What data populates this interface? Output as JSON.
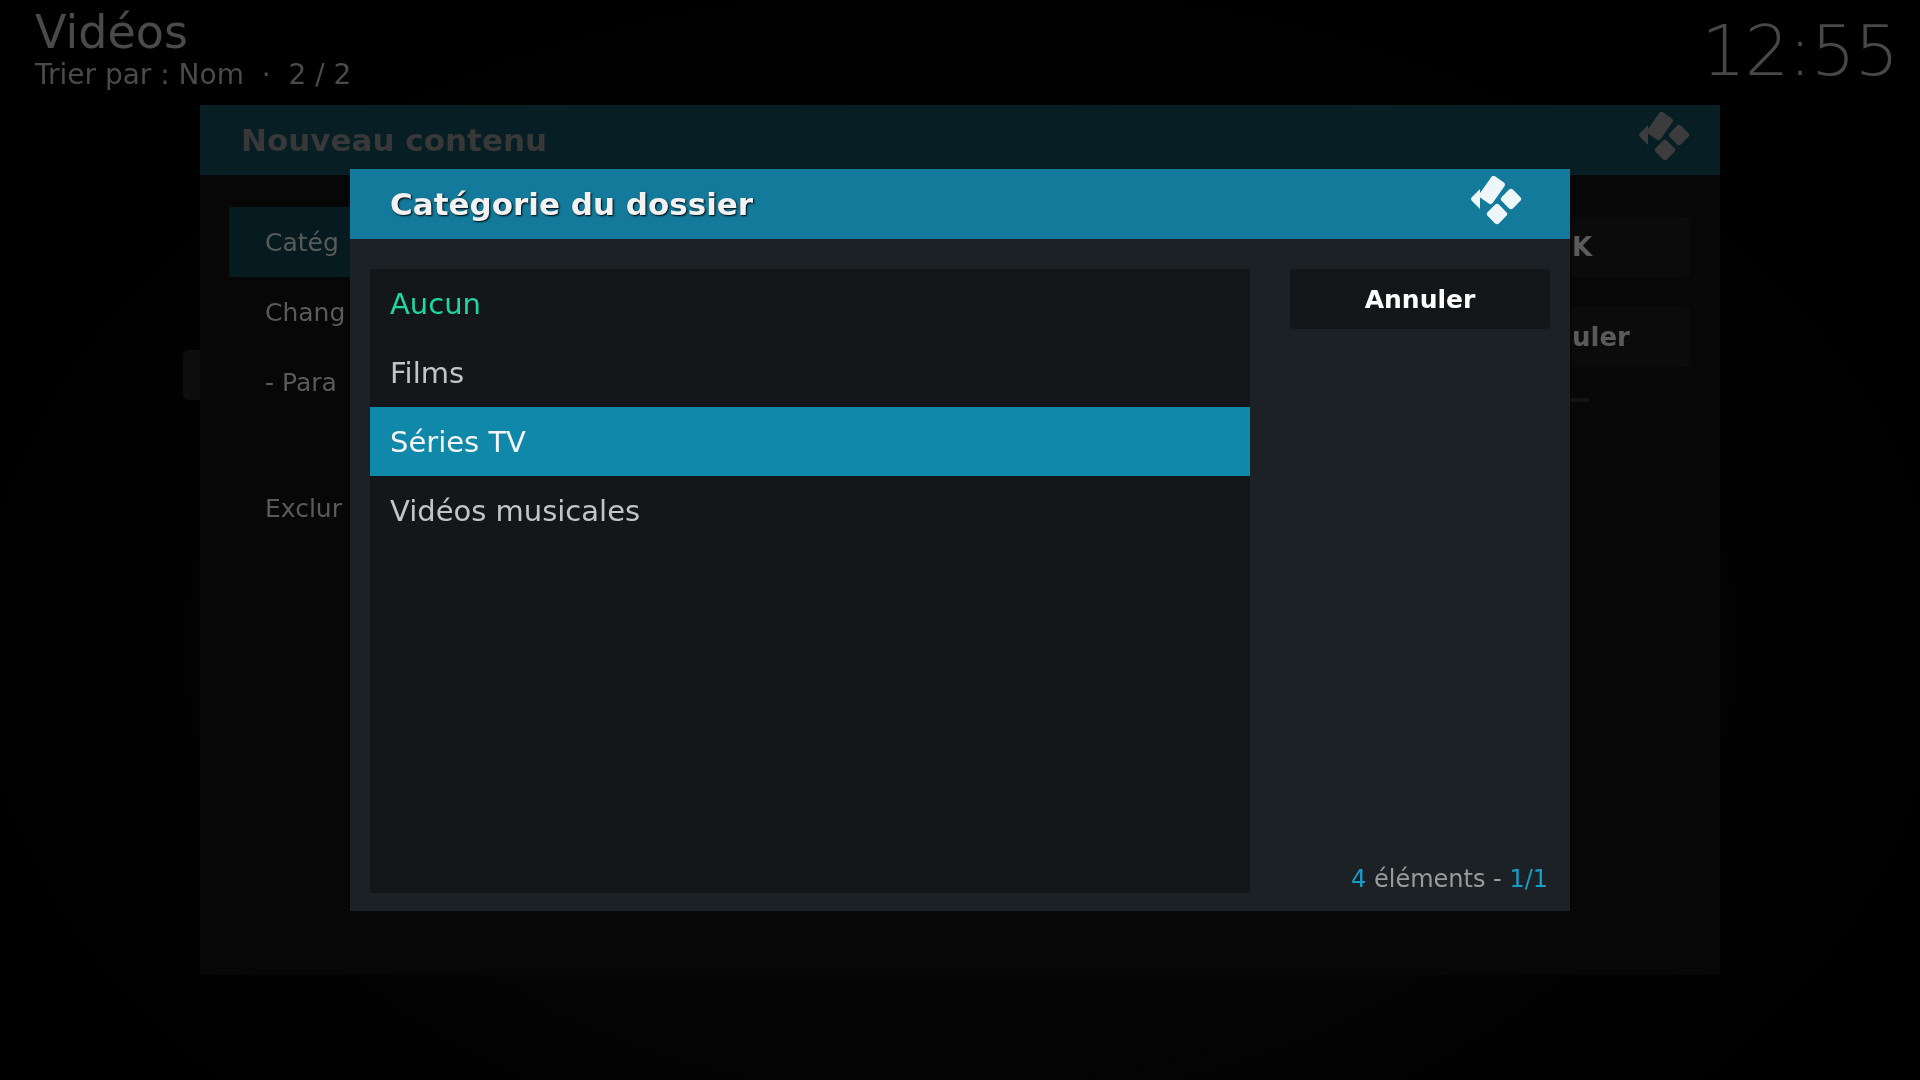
{
  "header": {
    "title": "Vidéos",
    "subtitle": "Trier par : Nom  ·  2 / 2",
    "clock": "12:55"
  },
  "back_dialog": {
    "title": "Nouveau contenu",
    "items": [
      {
        "label": "Catég",
        "selected": true
      },
      {
        "label": "Chang",
        "selected": false
      },
      {
        "label": "- Para",
        "selected": false
      },
      {
        "label": "Exclur",
        "selected": false
      }
    ],
    "buttons": [
      "K",
      "uler"
    ]
  },
  "dialog": {
    "title": "Catégorie du dossier",
    "items": [
      {
        "label": "Aucun",
        "selected": false,
        "current": true
      },
      {
        "label": "Films",
        "selected": false,
        "current": false
      },
      {
        "label": "Séries TV",
        "selected": true,
        "current": false
      },
      {
        "label": "Vidéos musicales",
        "selected": false,
        "current": false
      }
    ],
    "button": "Annuler",
    "footer": {
      "count": "4",
      "count_label": "éléments",
      "separator": "-",
      "page": "1/1"
    }
  }
}
